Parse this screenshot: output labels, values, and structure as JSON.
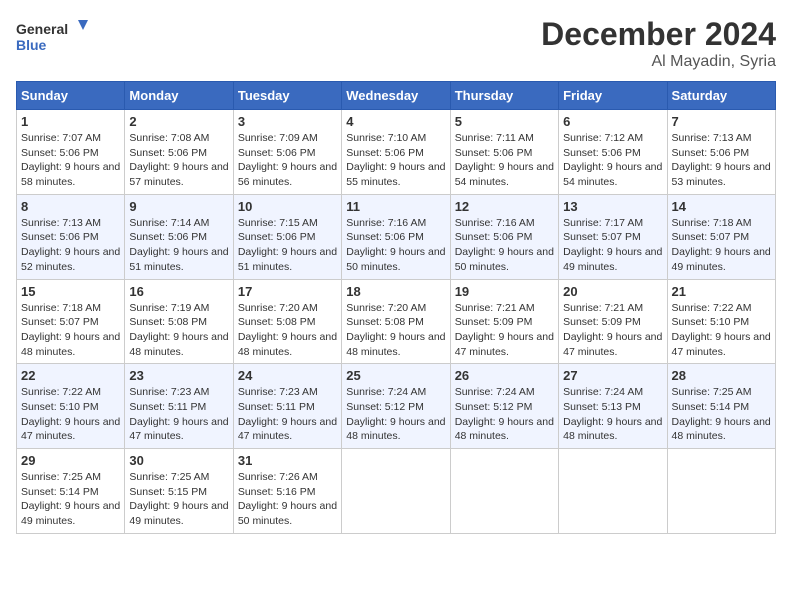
{
  "logo": {
    "line1": "General",
    "line2": "Blue"
  },
  "title": "December 2024",
  "subtitle": "Al Mayadin, Syria",
  "weekdays": [
    "Sunday",
    "Monday",
    "Tuesday",
    "Wednesday",
    "Thursday",
    "Friday",
    "Saturday"
  ],
  "weeks": [
    [
      {
        "day": "1",
        "sunrise": "Sunrise: 7:07 AM",
        "sunset": "Sunset: 5:06 PM",
        "daylight": "Daylight: 9 hours and 58 minutes."
      },
      {
        "day": "2",
        "sunrise": "Sunrise: 7:08 AM",
        "sunset": "Sunset: 5:06 PM",
        "daylight": "Daylight: 9 hours and 57 minutes."
      },
      {
        "day": "3",
        "sunrise": "Sunrise: 7:09 AM",
        "sunset": "Sunset: 5:06 PM",
        "daylight": "Daylight: 9 hours and 56 minutes."
      },
      {
        "day": "4",
        "sunrise": "Sunrise: 7:10 AM",
        "sunset": "Sunset: 5:06 PM",
        "daylight": "Daylight: 9 hours and 55 minutes."
      },
      {
        "day": "5",
        "sunrise": "Sunrise: 7:11 AM",
        "sunset": "Sunset: 5:06 PM",
        "daylight": "Daylight: 9 hours and 54 minutes."
      },
      {
        "day": "6",
        "sunrise": "Sunrise: 7:12 AM",
        "sunset": "Sunset: 5:06 PM",
        "daylight": "Daylight: 9 hours and 54 minutes."
      },
      {
        "day": "7",
        "sunrise": "Sunrise: 7:13 AM",
        "sunset": "Sunset: 5:06 PM",
        "daylight": "Daylight: 9 hours and 53 minutes."
      }
    ],
    [
      {
        "day": "8",
        "sunrise": "Sunrise: 7:13 AM",
        "sunset": "Sunset: 5:06 PM",
        "daylight": "Daylight: 9 hours and 52 minutes."
      },
      {
        "day": "9",
        "sunrise": "Sunrise: 7:14 AM",
        "sunset": "Sunset: 5:06 PM",
        "daylight": "Daylight: 9 hours and 51 minutes."
      },
      {
        "day": "10",
        "sunrise": "Sunrise: 7:15 AM",
        "sunset": "Sunset: 5:06 PM",
        "daylight": "Daylight: 9 hours and 51 minutes."
      },
      {
        "day": "11",
        "sunrise": "Sunrise: 7:16 AM",
        "sunset": "Sunset: 5:06 PM",
        "daylight": "Daylight: 9 hours and 50 minutes."
      },
      {
        "day": "12",
        "sunrise": "Sunrise: 7:16 AM",
        "sunset": "Sunset: 5:06 PM",
        "daylight": "Daylight: 9 hours and 50 minutes."
      },
      {
        "day": "13",
        "sunrise": "Sunrise: 7:17 AM",
        "sunset": "Sunset: 5:07 PM",
        "daylight": "Daylight: 9 hours and 49 minutes."
      },
      {
        "day": "14",
        "sunrise": "Sunrise: 7:18 AM",
        "sunset": "Sunset: 5:07 PM",
        "daylight": "Daylight: 9 hours and 49 minutes."
      }
    ],
    [
      {
        "day": "15",
        "sunrise": "Sunrise: 7:18 AM",
        "sunset": "Sunset: 5:07 PM",
        "daylight": "Daylight: 9 hours and 48 minutes."
      },
      {
        "day": "16",
        "sunrise": "Sunrise: 7:19 AM",
        "sunset": "Sunset: 5:08 PM",
        "daylight": "Daylight: 9 hours and 48 minutes."
      },
      {
        "day": "17",
        "sunrise": "Sunrise: 7:20 AM",
        "sunset": "Sunset: 5:08 PM",
        "daylight": "Daylight: 9 hours and 48 minutes."
      },
      {
        "day": "18",
        "sunrise": "Sunrise: 7:20 AM",
        "sunset": "Sunset: 5:08 PM",
        "daylight": "Daylight: 9 hours and 48 minutes."
      },
      {
        "day": "19",
        "sunrise": "Sunrise: 7:21 AM",
        "sunset": "Sunset: 5:09 PM",
        "daylight": "Daylight: 9 hours and 47 minutes."
      },
      {
        "day": "20",
        "sunrise": "Sunrise: 7:21 AM",
        "sunset": "Sunset: 5:09 PM",
        "daylight": "Daylight: 9 hours and 47 minutes."
      },
      {
        "day": "21",
        "sunrise": "Sunrise: 7:22 AM",
        "sunset": "Sunset: 5:10 PM",
        "daylight": "Daylight: 9 hours and 47 minutes."
      }
    ],
    [
      {
        "day": "22",
        "sunrise": "Sunrise: 7:22 AM",
        "sunset": "Sunset: 5:10 PM",
        "daylight": "Daylight: 9 hours and 47 minutes."
      },
      {
        "day": "23",
        "sunrise": "Sunrise: 7:23 AM",
        "sunset": "Sunset: 5:11 PM",
        "daylight": "Daylight: 9 hours and 47 minutes."
      },
      {
        "day": "24",
        "sunrise": "Sunrise: 7:23 AM",
        "sunset": "Sunset: 5:11 PM",
        "daylight": "Daylight: 9 hours and 47 minutes."
      },
      {
        "day": "25",
        "sunrise": "Sunrise: 7:24 AM",
        "sunset": "Sunset: 5:12 PM",
        "daylight": "Daylight: 9 hours and 48 minutes."
      },
      {
        "day": "26",
        "sunrise": "Sunrise: 7:24 AM",
        "sunset": "Sunset: 5:12 PM",
        "daylight": "Daylight: 9 hours and 48 minutes."
      },
      {
        "day": "27",
        "sunrise": "Sunrise: 7:24 AM",
        "sunset": "Sunset: 5:13 PM",
        "daylight": "Daylight: 9 hours and 48 minutes."
      },
      {
        "day": "28",
        "sunrise": "Sunrise: 7:25 AM",
        "sunset": "Sunset: 5:14 PM",
        "daylight": "Daylight: 9 hours and 48 minutes."
      }
    ],
    [
      {
        "day": "29",
        "sunrise": "Sunrise: 7:25 AM",
        "sunset": "Sunset: 5:14 PM",
        "daylight": "Daylight: 9 hours and 49 minutes."
      },
      {
        "day": "30",
        "sunrise": "Sunrise: 7:25 AM",
        "sunset": "Sunset: 5:15 PM",
        "daylight": "Daylight: 9 hours and 49 minutes."
      },
      {
        "day": "31",
        "sunrise": "Sunrise: 7:26 AM",
        "sunset": "Sunset: 5:16 PM",
        "daylight": "Daylight: 9 hours and 50 minutes."
      },
      null,
      null,
      null,
      null
    ]
  ]
}
